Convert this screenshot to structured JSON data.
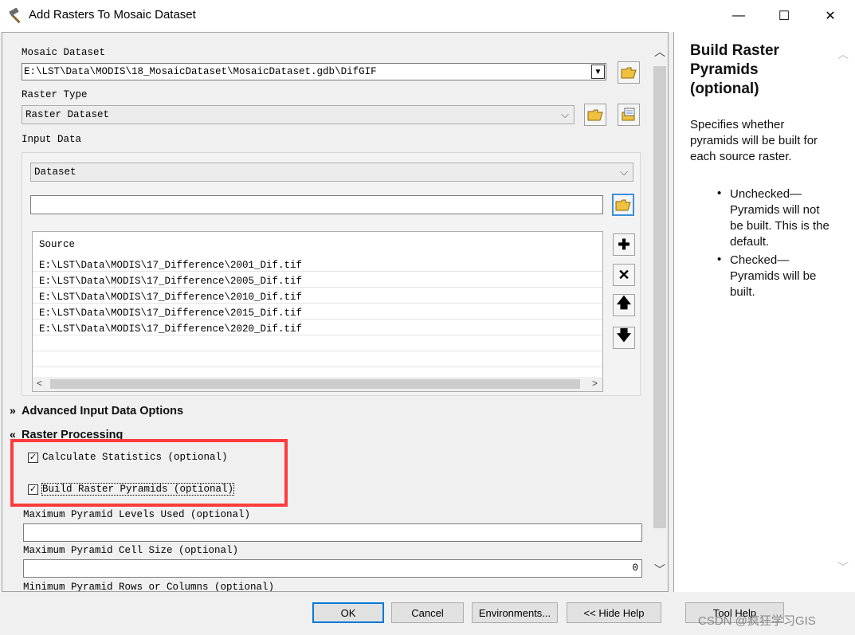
{
  "window": {
    "title": "Add Rasters To Mosaic Dataset",
    "minimize_glyph": "—",
    "maximize_glyph": "☐",
    "close_glyph": "✕"
  },
  "form": {
    "mosaic_dataset_label": "Mosaic Dataset",
    "mosaic_dataset_value": "E:\\LST\\Data\\MODIS\\18_MosaicDataset\\MosaicDataset.gdb\\DifGIF",
    "raster_type_label": "Raster Type",
    "raster_type_value": "Raster Dataset",
    "input_data_label": "Input Data",
    "input_type_value": "Dataset",
    "input_path_value": "",
    "source_header": "Source",
    "sources": [
      "E:\\LST\\Data\\MODIS\\17_Difference\\2001_Dif.tif",
      "E:\\LST\\Data\\MODIS\\17_Difference\\2005_Dif.tif",
      "E:\\LST\\Data\\MODIS\\17_Difference\\2010_Dif.tif",
      "E:\\LST\\Data\\MODIS\\17_Difference\\2015_Dif.tif",
      "E:\\LST\\Data\\MODIS\\17_Difference\\2020_Dif.tif"
    ],
    "advanced_section": "Advanced Input Data Options",
    "raster_processing_section": "Raster Processing",
    "calc_stats_label": "Calculate Statistics (optional)",
    "calc_stats_checked": true,
    "build_pyramids_label": "Build Raster Pyramids (optional)",
    "build_pyramids_checked": true,
    "max_pyramid_levels_label": "Maximum Pyramid Levels Used (optional)",
    "max_pyramid_levels_value": "",
    "max_pyramid_cell_label": "Maximum Pyramid Cell Size (optional)",
    "max_pyramid_cell_value": "0",
    "min_pyramid_rows_label": "Minimum Pyramid Rows or Columns (optional)"
  },
  "buttons": {
    "ok": "OK",
    "cancel": "Cancel",
    "environments": "Environments...",
    "hide_help": "<< Hide Help",
    "tool_help": "Tool Help"
  },
  "help": {
    "title": "Build Raster Pyramids (optional)",
    "intro": "Specifies whether pyramids will be built for each source raster.",
    "bullets": [
      "Unchecked—Pyramids will not be built. This is the default.",
      "Checked—Pyramids will be built."
    ]
  },
  "watermark": "CSDN @疯狂学习GIS",
  "colors": {
    "highlight_box": "#ff3b3b",
    "ok_border": "#0078d7"
  }
}
